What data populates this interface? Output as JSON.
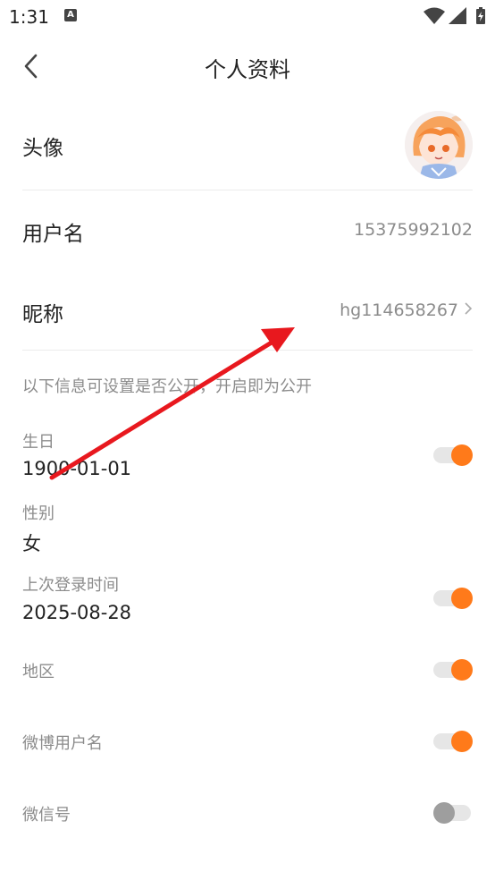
{
  "status_bar": {
    "time": "1:31",
    "notif_icon": "A"
  },
  "header": {
    "title": "个人资料"
  },
  "rows": {
    "avatar_label": "头像",
    "username_label": "用户名",
    "username_value": "15375992102",
    "nickname_label": "昵称",
    "nickname_value": "hg114658267"
  },
  "privacy": {
    "note": "以下信息可设置是否公开，开启即为公开",
    "items": [
      {
        "label": "生日",
        "value": "1900-01-01",
        "toggle_on": true
      },
      {
        "label": "性别",
        "value": "女",
        "toggle_on": null
      },
      {
        "label": "上次登录时间",
        "value": "2025-08-28",
        "toggle_on": true
      },
      {
        "label": "地区",
        "value": "",
        "toggle_on": true
      },
      {
        "label": "微博用户名",
        "value": "",
        "toggle_on": true
      },
      {
        "label": "微信号",
        "value": "",
        "toggle_on": false
      }
    ]
  },
  "colors": {
    "accent": "#ff7a1a",
    "annotation_arrow": "#e8181e"
  }
}
